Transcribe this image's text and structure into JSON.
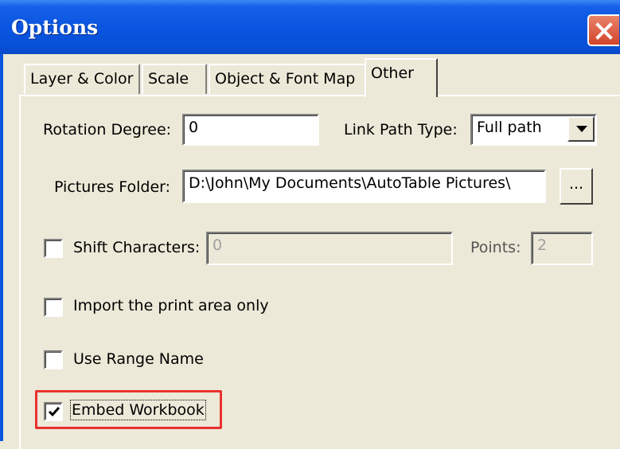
{
  "window": {
    "title": "Options"
  },
  "tabs": [
    {
      "label": "Layer & Color",
      "active": false
    },
    {
      "label": "Scale",
      "active": false
    },
    {
      "label": "Object & Font Map",
      "active": false
    },
    {
      "label": "Other",
      "active": true
    }
  ],
  "rotation": {
    "label": "Rotation Degree:",
    "value": "0"
  },
  "link_path": {
    "label": "Link Path Type:",
    "selected": "Full path"
  },
  "pictures_folder": {
    "label": "Pictures Folder:",
    "value": "D:\\John\\My Documents\\AutoTable Pictures\\",
    "browse_label": "..."
  },
  "shift_characters": {
    "label": "Shift Characters:",
    "checked": false,
    "value": "0",
    "points_label": "Points:",
    "points_value": "2"
  },
  "import_print_area": {
    "label": "Import the print area only",
    "checked": false
  },
  "use_range_name": {
    "label": "Use Range Name",
    "checked": false
  },
  "embed_workbook": {
    "label": "Embed Workbook",
    "checked": true
  },
  "colors": {
    "titlebar": "#0a55e0",
    "dialog_bg": "#ece9d8",
    "highlight": "#e8312f",
    "close_button": "#d2452a"
  },
  "icons": {
    "close": "close-icon",
    "dropdown": "chevron-down-icon",
    "check": "checkmark-icon"
  }
}
